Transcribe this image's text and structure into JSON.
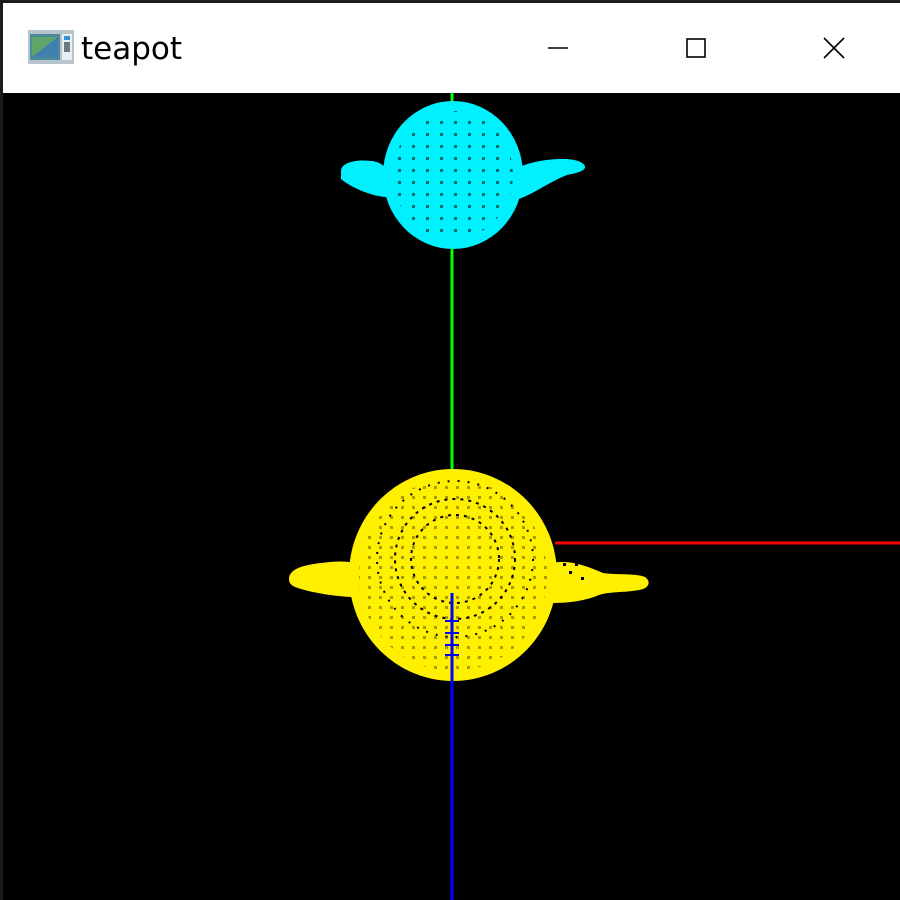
{
  "window": {
    "title": "teapot",
    "controls": {
      "minimize": "minimize",
      "maximize": "maximize",
      "close": "close"
    },
    "icon": "opengl-app-icon"
  },
  "scene": {
    "background": "#000000",
    "objects": [
      {
        "name": "teapot-cyan",
        "color": "#00f0ff",
        "view": "top"
      },
      {
        "name": "teapot-yellow",
        "color": "#fff000",
        "view": "top"
      }
    ],
    "axes": [
      {
        "name": "x-axis",
        "color": "#ff0000"
      },
      {
        "name": "y-axis",
        "color": "#00ff00"
      },
      {
        "name": "z-axis",
        "color": "#0000ff"
      }
    ]
  }
}
